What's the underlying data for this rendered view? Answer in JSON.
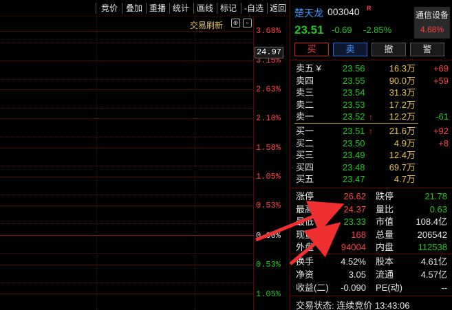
{
  "toolbar": {
    "items": [
      "竞价",
      "叠加",
      "重播",
      "统计",
      "画线",
      "标记",
      "-自选",
      "返回"
    ]
  },
  "chart": {
    "refresh_label": "交易刷新",
    "current_price_box": "24.97",
    "ticks": [
      {
        "label": "3.68%",
        "color": "#ff4040"
      },
      {
        "label": "3.15%",
        "color": "#ff4040"
      },
      {
        "label": "2.63%",
        "color": "#ff4040"
      },
      {
        "label": "2.10%",
        "color": "#ff4040"
      },
      {
        "label": "1.58%",
        "color": "#ff4040"
      },
      {
        "label": "1.05%",
        "color": "#ff4040"
      },
      {
        "label": "0.53%",
        "color": "#ff4040"
      },
      {
        "label": "0.00%",
        "color": "#e6e6e6"
      },
      {
        "label": "0.53%",
        "color": "#21c621"
      },
      {
        "label": "1.05%",
        "color": "#21c621"
      }
    ]
  },
  "stock": {
    "name": "楚天龙",
    "code": "003040",
    "badge": "R",
    "price": "23.51",
    "change": "-0.69",
    "change_pct": "-2.85%",
    "sector_name": "通信设备",
    "sector_pct": "4.68%"
  },
  "trade_buttons": {
    "buy": "买",
    "sell": "卖",
    "cancel": "撤",
    "alert": "警"
  },
  "asks": [
    {
      "label": "卖五 ¥",
      "price": "23.56",
      "vol": "16.3万",
      "delta": "+69",
      "delta_color": "red",
      "arrow": ""
    },
    {
      "label": "卖四",
      "price": "23.55",
      "vol": "90.0万",
      "delta": "+59",
      "delta_color": "red",
      "arrow": ""
    },
    {
      "label": "卖三",
      "price": "23.54",
      "vol": "31.3万",
      "delta": "",
      "delta_color": "red",
      "arrow": ""
    },
    {
      "label": "卖二",
      "price": "23.53",
      "vol": "17.2万",
      "delta": "",
      "delta_color": "red",
      "arrow": ""
    },
    {
      "label": "卖一",
      "price": "23.52",
      "vol": "12.2万",
      "delta": "-61",
      "delta_color": "green",
      "arrow": "↑"
    }
  ],
  "bids": [
    {
      "label": "买一",
      "price": "23.51",
      "vol": "21.6万",
      "delta": "+92",
      "delta_color": "red",
      "arrow": "↑"
    },
    {
      "label": "买二",
      "price": "23.50",
      "vol": "4.9万",
      "delta": "+8",
      "delta_color": "red",
      "arrow": ""
    },
    {
      "label": "买三",
      "price": "23.49",
      "vol": "12.4万",
      "delta": "",
      "delta_color": "red",
      "arrow": ""
    },
    {
      "label": "买四",
      "price": "23.48",
      "vol": "69.7万",
      "delta": "",
      "delta_color": "red",
      "arrow": ""
    },
    {
      "label": "买五",
      "price": "23.47",
      "vol": "4.7万",
      "delta": "",
      "delta_color": "red",
      "arrow": ""
    }
  ],
  "stats": [
    {
      "l1": "涨停",
      "v1": "26.62",
      "c1": "red",
      "l2": "跌停",
      "v2": "21.78",
      "c2": "green"
    },
    {
      "l1": "最高",
      "v1": "24.37",
      "c1": "red",
      "l2": "量比",
      "v2": "0.63",
      "c2": "green"
    },
    {
      "l1": "最低",
      "v1": "23.33",
      "c1": "green",
      "l2": "市值",
      "v2": "108.4亿",
      "c2": "white"
    },
    {
      "l1": "现量",
      "v1": "168",
      "c1": "red",
      "l2": "总量",
      "v2": "206542",
      "c2": "white"
    },
    {
      "l1": "外盘",
      "v1": "94004",
      "c1": "red",
      "l2": "内盘",
      "v2": "112538",
      "c2": "green"
    }
  ],
  "stats2": [
    {
      "l1": "换手",
      "v1": "4.52%",
      "c1": "white",
      "l2": "股本",
      "v2": "4.61亿",
      "c2": "white"
    },
    {
      "l1": "净资",
      "v1": "3.05",
      "c1": "white",
      "l2": "流通",
      "v2": "4.57亿",
      "c2": "white"
    },
    {
      "l1": "收益(二)",
      "v1": "-0.090",
      "c1": "white",
      "l2": "PE(动)",
      "v2": "--",
      "c2": "white"
    }
  ],
  "status": "交易状态: 连续竞价 13:43:06"
}
